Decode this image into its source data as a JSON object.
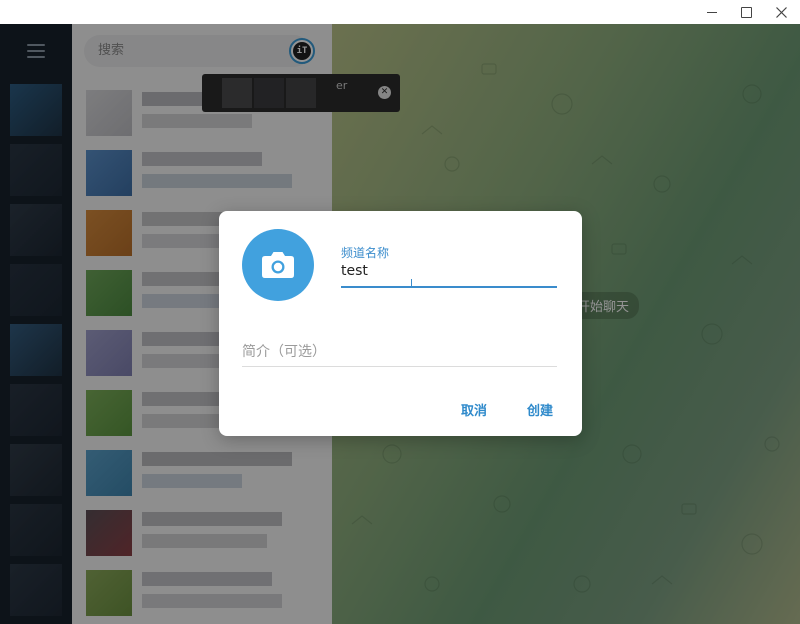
{
  "search": {
    "placeholder": "搜索"
  },
  "search_avatar": {
    "label": "iT"
  },
  "tooltip": {
    "visible_text": "er"
  },
  "chat_area": {
    "start_chat_text": "开始聊天"
  },
  "dialog": {
    "channel_name_label": "频道名称",
    "channel_name_value": "test",
    "description_placeholder": "简介（可选）",
    "cancel_label": "取消",
    "create_label": "创建"
  },
  "colors": {
    "accent": "#41a1de",
    "link": "#2f8acb",
    "sidebar": "#17212b"
  },
  "icons": [
    "hamburger-menu-icon",
    "camera-icon",
    "close-icon",
    "minimize-icon",
    "maximize-icon"
  ]
}
